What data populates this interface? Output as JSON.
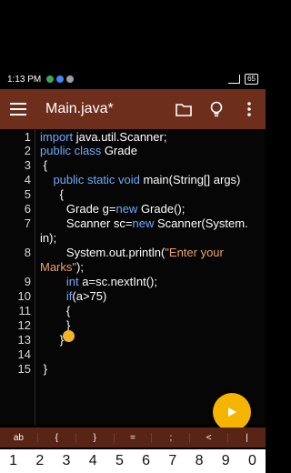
{
  "status": {
    "time": "1:13 PM",
    "battery": "65"
  },
  "appbar": {
    "title": "Main.java*",
    "icons": [
      "menu-icon",
      "folder-icon",
      "lightbulb-icon",
      "more-vert-icon"
    ]
  },
  "editor": {
    "lines": [
      {
        "n": "1",
        "segs": [
          {
            "t": "import",
            "c": "kw"
          },
          {
            "t": " java.util.Scanner;",
            "c": ""
          }
        ]
      },
      {
        "n": "2",
        "segs": [
          {
            "t": "public class",
            "c": "kw"
          },
          {
            "t": " Grade",
            "c": ""
          }
        ]
      },
      {
        "n": "3",
        "segs": [
          {
            "t": " {",
            "c": ""
          }
        ]
      },
      {
        "n": "4",
        "segs": [
          {
            "t": "    ",
            "c": ""
          },
          {
            "t": "public static void",
            "c": "kw"
          },
          {
            "t": " main(String[] args)",
            "c": ""
          }
        ]
      },
      {
        "n": "5",
        "segs": [
          {
            "t": "      {",
            "c": ""
          }
        ]
      },
      {
        "n": "6",
        "segs": [
          {
            "t": "        Grade g=",
            "c": ""
          },
          {
            "t": "new",
            "c": "kw"
          },
          {
            "t": " Grade();",
            "c": ""
          }
        ]
      },
      {
        "n": "7",
        "segs": [
          {
            "t": "        Scanner sc=",
            "c": ""
          },
          {
            "t": "new",
            "c": "kw"
          },
          {
            "t": " Scanner(System.",
            "c": ""
          }
        ]
      },
      {
        "n": "",
        "segs": [
          {
            "t": "in);",
            "c": ""
          }
        ]
      },
      {
        "n": "8",
        "segs": [
          {
            "t": "        System.out.println(",
            "c": ""
          },
          {
            "t": "\"Enter your",
            "c": "str"
          }
        ]
      },
      {
        "n": "",
        "segs": [
          {
            "t": "Marks\"",
            "c": "str"
          },
          {
            "t": ");",
            "c": ""
          }
        ]
      },
      {
        "n": "9",
        "segs": [
          {
            "t": "        ",
            "c": ""
          },
          {
            "t": "int",
            "c": "kw"
          },
          {
            "t": " a=sc.nextInt();",
            "c": ""
          }
        ]
      },
      {
        "n": "10",
        "segs": [
          {
            "t": "        ",
            "c": ""
          },
          {
            "t": "if",
            "c": "kw"
          },
          {
            "t": "(a>75)",
            "c": ""
          }
        ]
      },
      {
        "n": "11",
        "segs": [
          {
            "t": "        {",
            "c": ""
          }
        ]
      },
      {
        "n": "12",
        "segs": [
          {
            "t": "        }",
            "c": ""
          }
        ]
      },
      {
        "n": "13",
        "segs": [
          {
            "t": "      }",
            "c": ""
          }
        ]
      },
      {
        "n": "14",
        "segs": [
          {
            "t": "",
            "c": ""
          }
        ]
      },
      {
        "n": "15",
        "segs": [
          {
            "t": " }",
            "c": ""
          }
        ]
      }
    ]
  },
  "symbols": [
    "ab",
    "{",
    "}",
    "=",
    ";",
    "<",
    "|"
  ],
  "numbers": [
    "1",
    "2",
    "3",
    "4",
    "5",
    "6",
    "7",
    "8",
    "9",
    "0"
  ]
}
